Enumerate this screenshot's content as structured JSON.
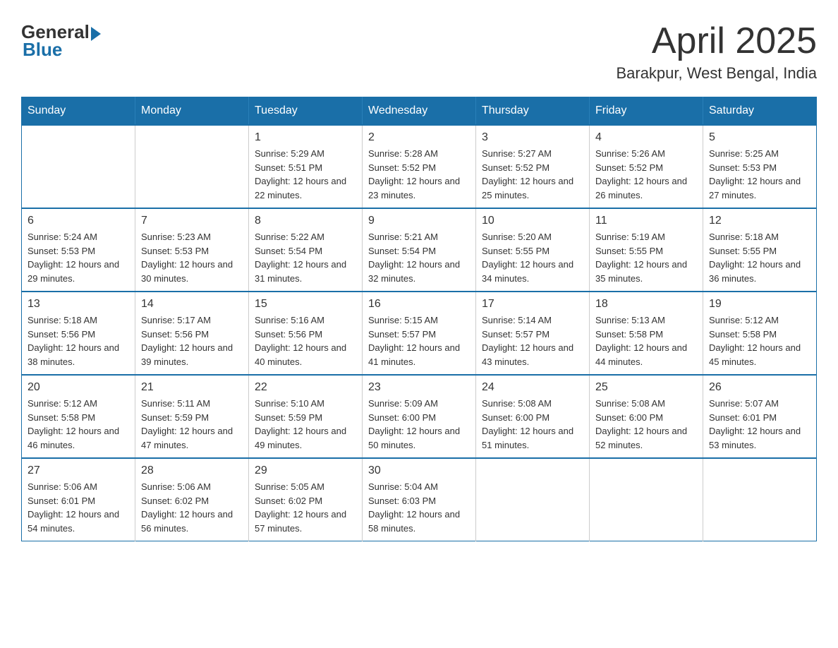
{
  "header": {
    "logo_general": "General",
    "logo_blue": "Blue",
    "month_title": "April 2025",
    "location": "Barakpur, West Bengal, India"
  },
  "days_of_week": [
    "Sunday",
    "Monday",
    "Tuesday",
    "Wednesday",
    "Thursday",
    "Friday",
    "Saturday"
  ],
  "weeks": [
    [
      {
        "day": "",
        "sunrise": "",
        "sunset": "",
        "daylight": ""
      },
      {
        "day": "",
        "sunrise": "",
        "sunset": "",
        "daylight": ""
      },
      {
        "day": "1",
        "sunrise": "Sunrise: 5:29 AM",
        "sunset": "Sunset: 5:51 PM",
        "daylight": "Daylight: 12 hours and 22 minutes."
      },
      {
        "day": "2",
        "sunrise": "Sunrise: 5:28 AM",
        "sunset": "Sunset: 5:52 PM",
        "daylight": "Daylight: 12 hours and 23 minutes."
      },
      {
        "day": "3",
        "sunrise": "Sunrise: 5:27 AM",
        "sunset": "Sunset: 5:52 PM",
        "daylight": "Daylight: 12 hours and 25 minutes."
      },
      {
        "day": "4",
        "sunrise": "Sunrise: 5:26 AM",
        "sunset": "Sunset: 5:52 PM",
        "daylight": "Daylight: 12 hours and 26 minutes."
      },
      {
        "day": "5",
        "sunrise": "Sunrise: 5:25 AM",
        "sunset": "Sunset: 5:53 PM",
        "daylight": "Daylight: 12 hours and 27 minutes."
      }
    ],
    [
      {
        "day": "6",
        "sunrise": "Sunrise: 5:24 AM",
        "sunset": "Sunset: 5:53 PM",
        "daylight": "Daylight: 12 hours and 29 minutes."
      },
      {
        "day": "7",
        "sunrise": "Sunrise: 5:23 AM",
        "sunset": "Sunset: 5:53 PM",
        "daylight": "Daylight: 12 hours and 30 minutes."
      },
      {
        "day": "8",
        "sunrise": "Sunrise: 5:22 AM",
        "sunset": "Sunset: 5:54 PM",
        "daylight": "Daylight: 12 hours and 31 minutes."
      },
      {
        "day": "9",
        "sunrise": "Sunrise: 5:21 AM",
        "sunset": "Sunset: 5:54 PM",
        "daylight": "Daylight: 12 hours and 32 minutes."
      },
      {
        "day": "10",
        "sunrise": "Sunrise: 5:20 AM",
        "sunset": "Sunset: 5:55 PM",
        "daylight": "Daylight: 12 hours and 34 minutes."
      },
      {
        "day": "11",
        "sunrise": "Sunrise: 5:19 AM",
        "sunset": "Sunset: 5:55 PM",
        "daylight": "Daylight: 12 hours and 35 minutes."
      },
      {
        "day": "12",
        "sunrise": "Sunrise: 5:18 AM",
        "sunset": "Sunset: 5:55 PM",
        "daylight": "Daylight: 12 hours and 36 minutes."
      }
    ],
    [
      {
        "day": "13",
        "sunrise": "Sunrise: 5:18 AM",
        "sunset": "Sunset: 5:56 PM",
        "daylight": "Daylight: 12 hours and 38 minutes."
      },
      {
        "day": "14",
        "sunrise": "Sunrise: 5:17 AM",
        "sunset": "Sunset: 5:56 PM",
        "daylight": "Daylight: 12 hours and 39 minutes."
      },
      {
        "day": "15",
        "sunrise": "Sunrise: 5:16 AM",
        "sunset": "Sunset: 5:56 PM",
        "daylight": "Daylight: 12 hours and 40 minutes."
      },
      {
        "day": "16",
        "sunrise": "Sunrise: 5:15 AM",
        "sunset": "Sunset: 5:57 PM",
        "daylight": "Daylight: 12 hours and 41 minutes."
      },
      {
        "day": "17",
        "sunrise": "Sunrise: 5:14 AM",
        "sunset": "Sunset: 5:57 PM",
        "daylight": "Daylight: 12 hours and 43 minutes."
      },
      {
        "day": "18",
        "sunrise": "Sunrise: 5:13 AM",
        "sunset": "Sunset: 5:58 PM",
        "daylight": "Daylight: 12 hours and 44 minutes."
      },
      {
        "day": "19",
        "sunrise": "Sunrise: 5:12 AM",
        "sunset": "Sunset: 5:58 PM",
        "daylight": "Daylight: 12 hours and 45 minutes."
      }
    ],
    [
      {
        "day": "20",
        "sunrise": "Sunrise: 5:12 AM",
        "sunset": "Sunset: 5:58 PM",
        "daylight": "Daylight: 12 hours and 46 minutes."
      },
      {
        "day": "21",
        "sunrise": "Sunrise: 5:11 AM",
        "sunset": "Sunset: 5:59 PM",
        "daylight": "Daylight: 12 hours and 47 minutes."
      },
      {
        "day": "22",
        "sunrise": "Sunrise: 5:10 AM",
        "sunset": "Sunset: 5:59 PM",
        "daylight": "Daylight: 12 hours and 49 minutes."
      },
      {
        "day": "23",
        "sunrise": "Sunrise: 5:09 AM",
        "sunset": "Sunset: 6:00 PM",
        "daylight": "Daylight: 12 hours and 50 minutes."
      },
      {
        "day": "24",
        "sunrise": "Sunrise: 5:08 AM",
        "sunset": "Sunset: 6:00 PM",
        "daylight": "Daylight: 12 hours and 51 minutes."
      },
      {
        "day": "25",
        "sunrise": "Sunrise: 5:08 AM",
        "sunset": "Sunset: 6:00 PM",
        "daylight": "Daylight: 12 hours and 52 minutes."
      },
      {
        "day": "26",
        "sunrise": "Sunrise: 5:07 AM",
        "sunset": "Sunset: 6:01 PM",
        "daylight": "Daylight: 12 hours and 53 minutes."
      }
    ],
    [
      {
        "day": "27",
        "sunrise": "Sunrise: 5:06 AM",
        "sunset": "Sunset: 6:01 PM",
        "daylight": "Daylight: 12 hours and 54 minutes."
      },
      {
        "day": "28",
        "sunrise": "Sunrise: 5:06 AM",
        "sunset": "Sunset: 6:02 PM",
        "daylight": "Daylight: 12 hours and 56 minutes."
      },
      {
        "day": "29",
        "sunrise": "Sunrise: 5:05 AM",
        "sunset": "Sunset: 6:02 PM",
        "daylight": "Daylight: 12 hours and 57 minutes."
      },
      {
        "day": "30",
        "sunrise": "Sunrise: 5:04 AM",
        "sunset": "Sunset: 6:03 PM",
        "daylight": "Daylight: 12 hours and 58 minutes."
      },
      {
        "day": "",
        "sunrise": "",
        "sunset": "",
        "daylight": ""
      },
      {
        "day": "",
        "sunrise": "",
        "sunset": "",
        "daylight": ""
      },
      {
        "day": "",
        "sunrise": "",
        "sunset": "",
        "daylight": ""
      }
    ]
  ]
}
